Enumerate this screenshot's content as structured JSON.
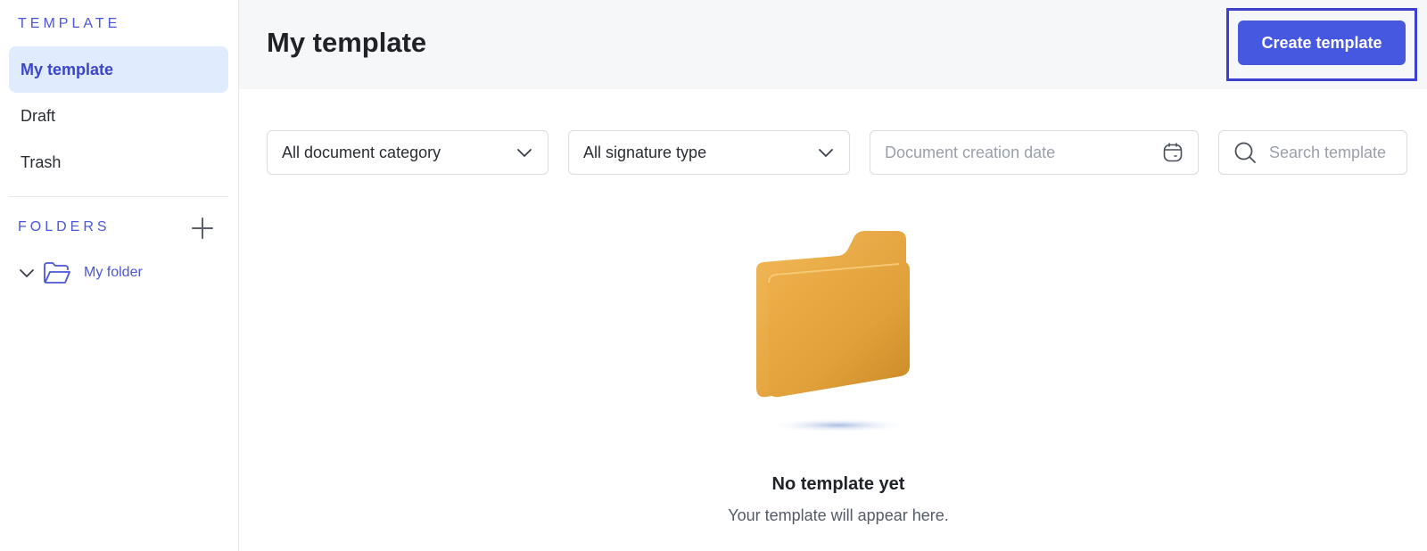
{
  "sidebar": {
    "template_heading": "TEMPLATE",
    "items": [
      {
        "label": "My template",
        "active": true
      },
      {
        "label": "Draft",
        "active": false
      },
      {
        "label": "Trash",
        "active": false
      }
    ],
    "folders_heading": "FOLDERS",
    "add_folder_icon": "plus-icon",
    "folders": [
      {
        "label": "My folder",
        "expanded": true,
        "icon": "folder-open-icon"
      }
    ]
  },
  "header": {
    "title": "My template",
    "create_button_label": "Create template"
  },
  "filters": {
    "category": "All document category",
    "signature_type": "All signature type",
    "date_placeholder": "Document creation date",
    "search_placeholder": "Search template"
  },
  "empty_state": {
    "title": "No template yet",
    "subtitle": "Your template will appear here.",
    "illustration_icon": "folder-illustration"
  },
  "colors": {
    "accent": "#4658df",
    "active_bg": "#e0ebfd",
    "header_bg": "#f6f7f9",
    "highlight_border": "#3d3fd0"
  }
}
